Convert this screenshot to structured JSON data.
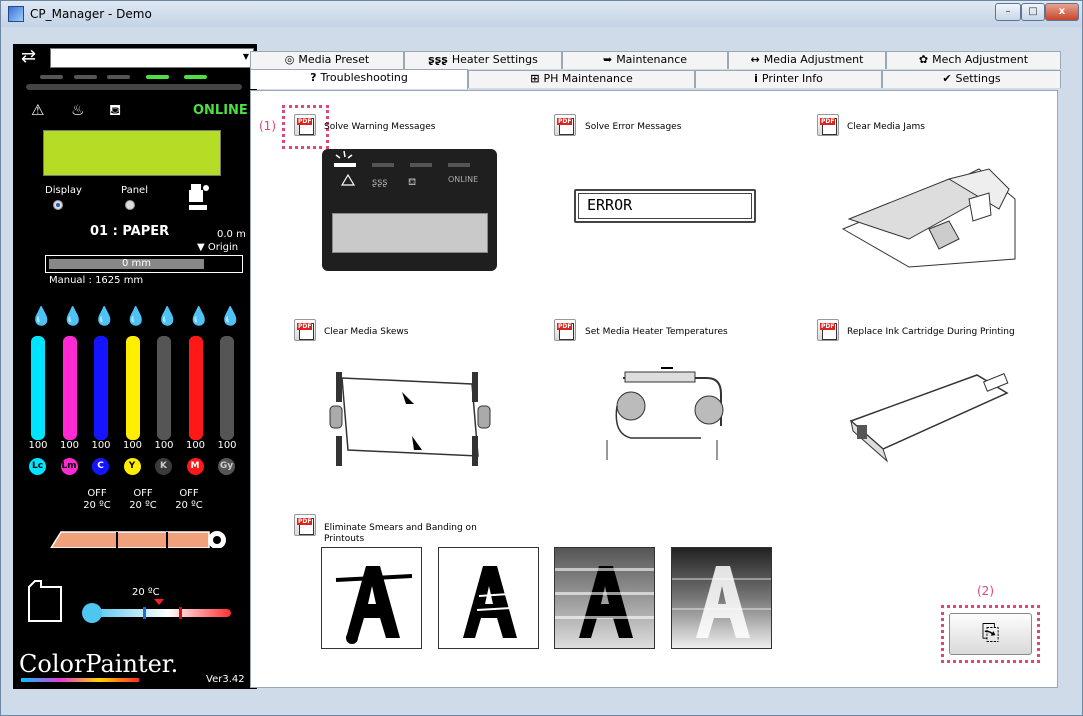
{
  "window": {
    "title": "CP_Manager - Demo",
    "min_label": "–",
    "max_label": "□",
    "close_label": "x"
  },
  "left": {
    "selector_arrow": "⇄",
    "status_icons": [
      "⚠",
      "♨",
      "⛾"
    ],
    "online": "ONLINE",
    "display_label": "Display",
    "panel_label": "Panel",
    "paper": "01 : PAPER",
    "paper_len": "0.0 m",
    "origin": "▼ Origin",
    "pos_value": "0  mm",
    "manual": "Manual : 1625  mm",
    "inks": [
      {
        "code": "Lc",
        "value": "100",
        "color": "#00e5ff",
        "text": "#000"
      },
      {
        "code": "Lm",
        "value": "100",
        "color": "#ff2ad4",
        "text": "#000"
      },
      {
        "code": "C",
        "value": "100",
        "color": "#1414ff",
        "text": "#fff"
      },
      {
        "code": "Y",
        "value": "100",
        "color": "#ffee00",
        "text": "#000"
      },
      {
        "code": "K",
        "value": "100",
        "color": "#3a3a3a",
        "text": "#ccc"
      },
      {
        "code": "M",
        "value": "100",
        "color": "#ff1818",
        "text": "#fff"
      },
      {
        "code": "Gy",
        "value": "100",
        "color": "#555555",
        "text": "#ccc"
      }
    ],
    "heaters": [
      {
        "state": "OFF",
        "temp": "20 ºC"
      },
      {
        "state": "OFF",
        "temp": "20 ºC"
      },
      {
        "state": "OFF",
        "temp": "20 ºC"
      }
    ],
    "room_temp": "20 ºC",
    "logo": "ColorPainter.",
    "version": "Ver3.42"
  },
  "tabs_top": [
    {
      "icon": "◎",
      "label": "Media Preset"
    },
    {
      "icon": "ʂʂʂ",
      "label": "Heater Settings"
    },
    {
      "icon": "➥",
      "label": "Maintenance"
    },
    {
      "icon": "↔",
      "label": "Media Adjustment"
    },
    {
      "icon": "✿",
      "label": "Mech Adjustment"
    }
  ],
  "tabs_bottom": [
    {
      "icon": "?",
      "label": "Troubleshooting"
    },
    {
      "icon": "⊞",
      "label": "PH Maintenance"
    },
    {
      "icon": "i",
      "label": "Printer Info"
    },
    {
      "icon": "✔",
      "label": "Settings"
    }
  ],
  "items": [
    {
      "label": "Solve Warning Messages"
    },
    {
      "label": "Solve Error Messages"
    },
    {
      "label": "Clear Media Jams"
    },
    {
      "label": "Clear Media Skews"
    },
    {
      "label": "Set Media Heater Temperatures"
    },
    {
      "label": "Replace Ink Cartridge During Printing"
    },
    {
      "label": "Eliminate Smears and Banding on Printouts"
    }
  ],
  "error_text": "ERROR",
  "panel_online": "ONLINE",
  "callouts": [
    "(1)",
    "(2)"
  ],
  "copy_icon": "⎘"
}
